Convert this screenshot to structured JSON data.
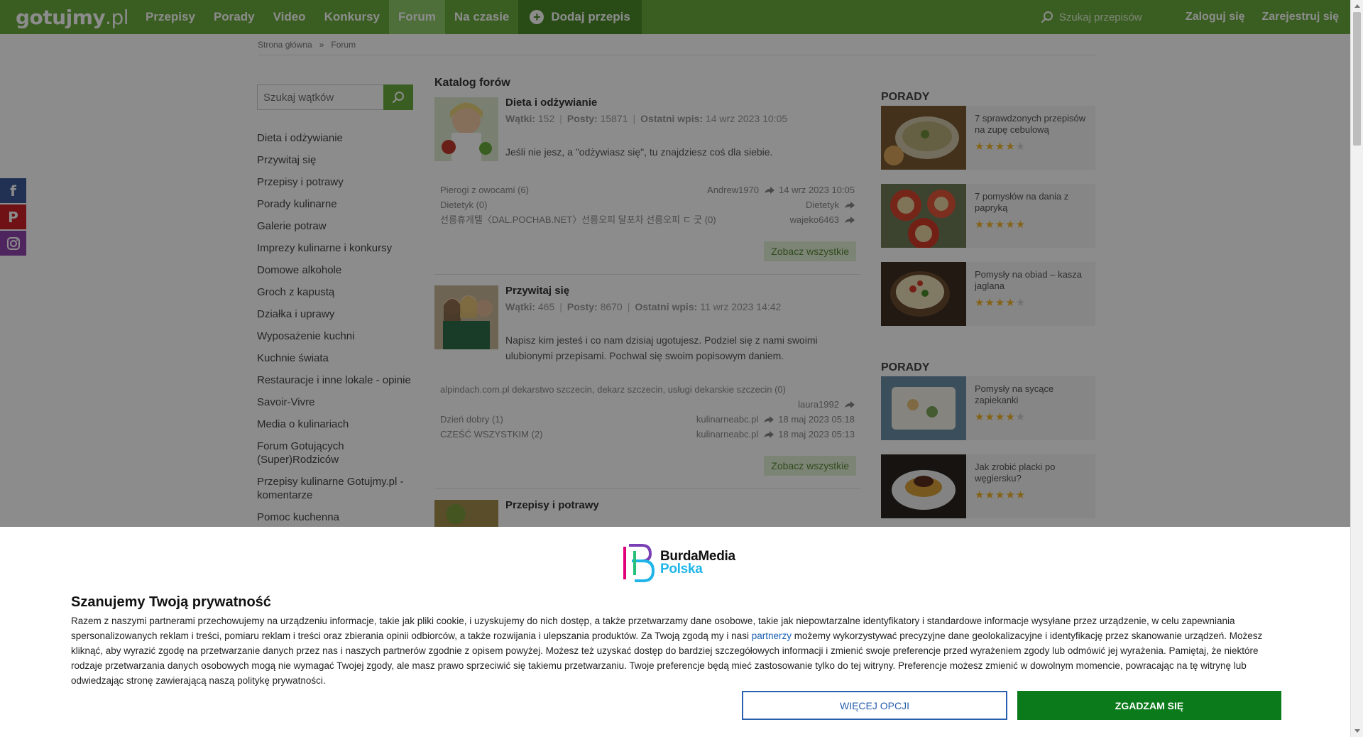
{
  "header": {
    "logo_main": "gotujmy",
    "logo_suffix": ".pl",
    "nav": [
      "Przepisy",
      "Porady",
      "Video",
      "Konkursy",
      "Forum",
      "Na czasie"
    ],
    "add_recipe": "Dodaj przepis",
    "search_placeholder": "Szukaj przepisów",
    "login": "Zaloguj się",
    "register": "Zarejestruj się",
    "colors": {
      "nav_bg": "#6aac3c",
      "active_bg": "#8fc96a",
      "add_bg": "#4c8a28"
    }
  },
  "breadcrumb": {
    "home": "Strona główna",
    "sep": "»",
    "current": "Forum"
  },
  "sidebar": {
    "search_placeholder": "Szukaj wątków",
    "categories": [
      "Dieta i odżywianie",
      "Przywitaj się",
      "Przepisy i potrawy",
      "Porady kulinarne",
      "Galerie potraw",
      "Imprezy kulinarne i konkursy",
      "Domowe alkohole",
      "Groch z kapustą",
      "Działka i uprawy",
      "Wyposażenie kuchni",
      "Kuchnie świata",
      "Restauracje i inne lokale - opinie",
      "Savoir-Vivre",
      "Media o kulinariach",
      "Forum Gotujących (Super)Rodziców",
      "Przepisy kulinarne Gotujmy.pl - komentarze",
      "Pomoc kuchenna"
    ]
  },
  "main": {
    "title": "Katalog forów",
    "forums": [
      {
        "name": "Dieta i odżywianie",
        "threads_label": "Wątki:",
        "threads": "152",
        "posts_label": "Posty:",
        "posts": "15871",
        "last_label": "Ostatni wpis:",
        "last": "14 wrz 2023 10:05",
        "desc": "Jeśli nie jesz, a \"odżywiasz się\", tu znajdziesz coś dla siebie.",
        "topics": [
          {
            "title": "Pierogi z owocami (6)",
            "user": "Andrew1970",
            "date": "14 wrz 2023 10:05"
          },
          {
            "title": "Dietetyk (0)",
            "user": "Dietetyk",
            "date": ""
          },
          {
            "title": "선릉휴게텔〈DAL.POCHAB.NET〉선릉오피 달포차 선릉오피 ㄷ 굿 (0)",
            "user": "wajeko6463",
            "date": ""
          }
        ],
        "see_all": "Zobacz wszystkie"
      },
      {
        "name": "Przywitaj się",
        "threads_label": "Wątki:",
        "threads": "465",
        "posts_label": "Posty:",
        "posts": "8670",
        "last_label": "Ostatni wpis:",
        "last": "11 wrz 2023 14:42",
        "desc": "Napisz kim jesteś i co nam dzisiaj ugotujesz. Podziel się z nami swoimi ulubionymi przepisami. Pochwal się swoim popisowym daniem.",
        "topics": [
          {
            "title": "alpindach.com.pl dekarstwo szczecin, dekarz szczecin, usługi dekarskie szczecin (0)",
            "user": "laura1992",
            "date": ""
          },
          {
            "title": "Dzień dobry (1)",
            "user": "kulinarneabc.pl",
            "date": "18 maj 2023 05:18"
          },
          {
            "title": "CZEŚĆ WSZYSTKIM (2)",
            "user": "kulinarneabc.pl",
            "date": "18 maj 2023 05:13"
          }
        ],
        "see_all": "Zobacz wszystkie"
      },
      {
        "name": "Przepisy i potrawy"
      }
    ]
  },
  "right": {
    "sections": [
      {
        "title": "PORADY",
        "items": [
          {
            "title": "7 sprawdzonych przepisów na zupę cebulową",
            "rating": 4
          },
          {
            "title": "7 pomysłów na dania z papryką",
            "rating": 5
          },
          {
            "title": "Pomysły na obiad – kasza jaglana",
            "rating": 4
          }
        ]
      },
      {
        "title": "PORADY",
        "items": [
          {
            "title": "Pomysły na sycące zapiekanki",
            "rating": 4
          },
          {
            "title": "Jak zrobić placki po węgiersku?",
            "rating": 5
          }
        ]
      }
    ]
  },
  "consent": {
    "brand_top": "BurdaMedia",
    "brand_bottom": "Polska",
    "title": "Szanujemy Twoją prywatność",
    "text_before_link": "Razem z naszymi partnerami przechowujemy na urządzeniu informacje, takie jak pliki cookie, i uzyskujemy do nich dostęp, a także przetwarzamy dane osobowe, takie jak niepowtarzalne identyfikatory i standardowe informacje wysyłane przez urządzenie, w celu zapewniania spersonalizowanych reklam i treści, pomiaru reklam i treści oraz zbierania opinii odbiorców, a także rozwijania i ulepszania produktów. Za Twoją zgodą my i nasi",
    "link": "partnerzy",
    "text_after_link": "możemy wykorzystywać precyzyjne dane geolokalizacyjne i identyfikację przez skanowanie urządzeń. Możesz kliknąć, aby wyrazić zgodę na przetwarzanie danych przez nas i naszych partnerów zgodnie z opisem powyżej. Możesz też uzyskać dostęp do bardziej szczegółowych informacji i zmienić swoje preferencje przed wyrażeniem zgody lub odmówić jej wyrażenia. Pamiętaj, że niektóre rodzaje przetwarzania danych osobowych mogą nie wymagać Twojej zgody, ale masz prawo sprzeciwić się takiemu przetwarzaniu. Twoje preferencje będą mieć zastosowanie tylko do tej witryny. Preferencje możesz zmienić w dowolnym momencie, powracając na tę witrynę lub odwiedzając stronę zawierającą naszą politykę prywatności.",
    "more_options": "WIĘCEJ OPCJI",
    "agree": "ZGADZAM SIĘ",
    "colors": {
      "agree_bg": "#0b7a1a",
      "more_border": "#2a5fae"
    }
  }
}
